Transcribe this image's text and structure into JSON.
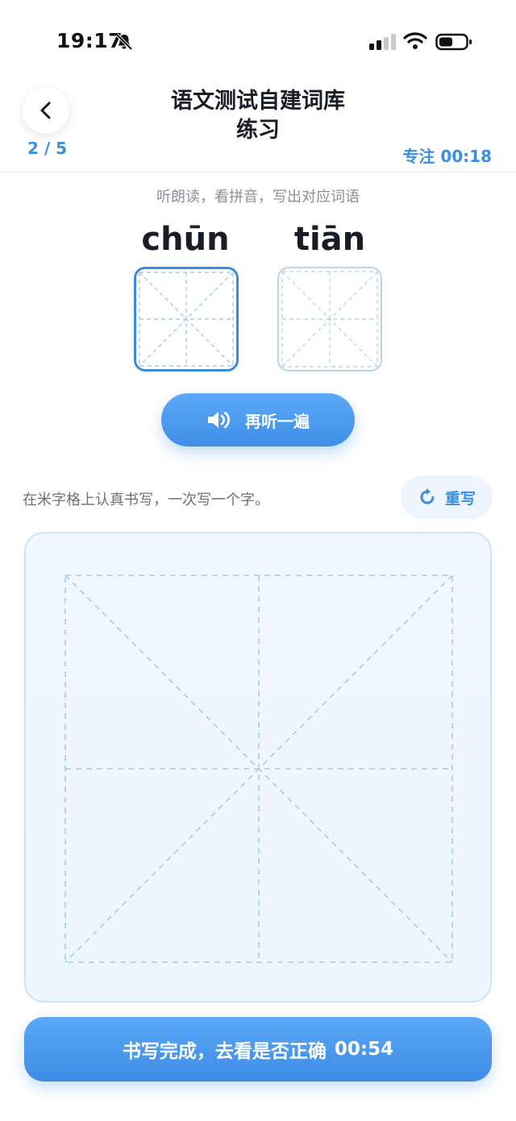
{
  "status_bar": {
    "time": "19:17"
  },
  "header": {
    "title_line1": "语文测试自建词库",
    "title_line2": "练习",
    "progress": "2 / 5",
    "focus_timer": "专注 00:18"
  },
  "prompt": {
    "instruction": "听朗读，看拼音，写出对应词语",
    "pinyin": [
      "chūn",
      "tiān"
    ],
    "listen_again": "再听一遍"
  },
  "writing": {
    "hint": "在米字格上认真书写，一次写一个字。",
    "rewrite": "重写"
  },
  "footer": {
    "submit_label": "书写完成，去看是否正确",
    "submit_timer": "00:54"
  },
  "colors": {
    "accent": "#3b8fe0",
    "grid_line": "#a9cbe6"
  }
}
